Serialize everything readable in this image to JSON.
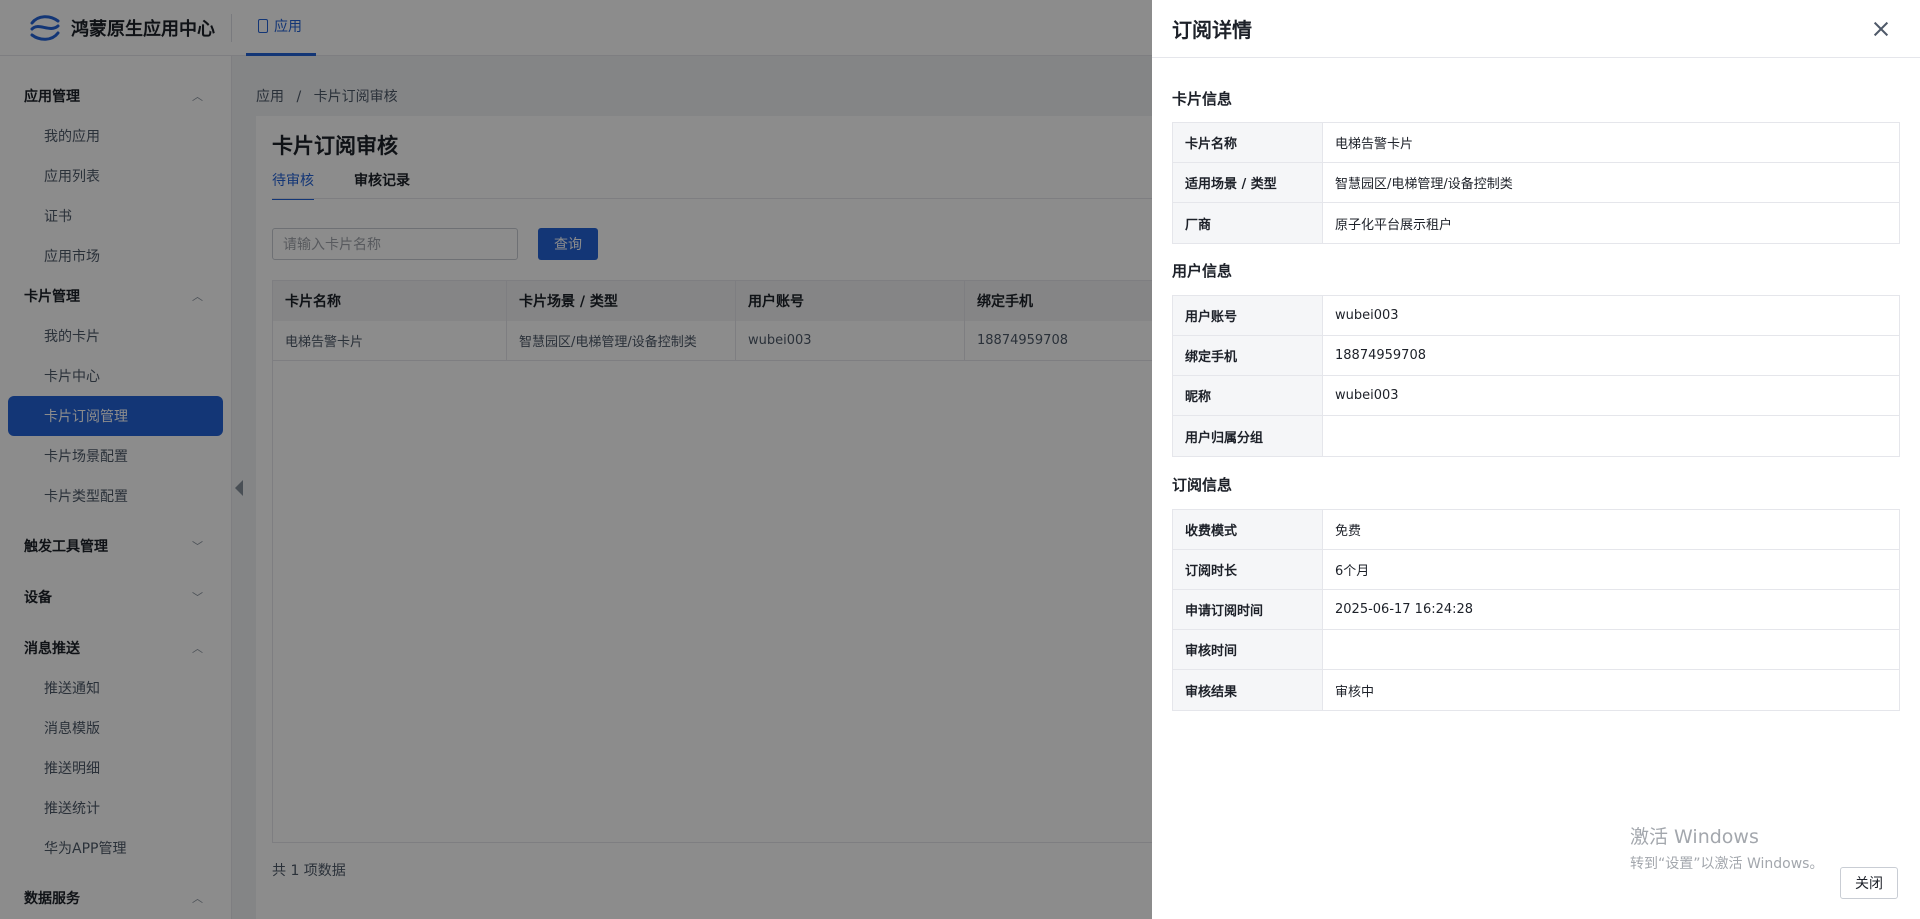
{
  "header": {
    "app_title": "鸿蒙原生应用中心",
    "top_tab": "应用"
  },
  "sidebar": {
    "groups": [
      {
        "label": "应用管理",
        "expanded": true,
        "items": [
          "我的应用",
          "应用列表",
          "证书",
          "应用市场"
        ]
      },
      {
        "label": "卡片管理",
        "expanded": true,
        "items": [
          "我的卡片",
          "卡片中心",
          "卡片订阅管理",
          "卡片场景配置",
          "卡片类型配置"
        ]
      },
      {
        "label": "触发工具管理",
        "expanded": false,
        "items": []
      },
      {
        "label": "设备",
        "expanded": false,
        "items": []
      },
      {
        "label": "消息推送",
        "expanded": true,
        "items": [
          "推送通知",
          "消息模版",
          "推送明细",
          "推送统计",
          "华为APP管理"
        ]
      },
      {
        "label": "数据服务",
        "expanded": true,
        "items": []
      }
    ],
    "active_item": "卡片订阅管理"
  },
  "breadcrumb": [
    "应用",
    "/",
    "卡片订阅审核"
  ],
  "page": {
    "title": "卡片订阅审核",
    "tabs": [
      "待审核",
      "审核记录"
    ],
    "active_tab": "待审核",
    "search_placeholder": "请输入卡片名称",
    "query_label": "查询",
    "table": {
      "columns": [
        "卡片名称",
        "卡片场景 / 类型",
        "用户账号",
        "绑定手机"
      ],
      "rows": [
        [
          "电梯告警卡片",
          "智慧园区/电梯管理/设备控制类",
          "wubei003",
          "18874959708"
        ]
      ]
    },
    "total": "共 1 项数据"
  },
  "drawer": {
    "title": "订阅详情",
    "sections": [
      {
        "title": "卡片信息",
        "rows": [
          {
            "label": "卡片名称",
            "value": "电梯告警卡片"
          },
          {
            "label": "适用场景 / 类型",
            "value": "智慧园区/电梯管理/设备控制类"
          },
          {
            "label": "厂商",
            "value": "原子化平台展示租户"
          }
        ]
      },
      {
        "title": "用户信息",
        "rows": [
          {
            "label": "用户账号",
            "value": "wubei003"
          },
          {
            "label": "绑定手机",
            "value": "18874959708"
          },
          {
            "label": "昵称",
            "value": "wubei003"
          },
          {
            "label": "用户归属分组",
            "value": ""
          }
        ]
      },
      {
        "title": "订阅信息",
        "rows": [
          {
            "label": "收费模式",
            "value": "免费"
          },
          {
            "label": "订阅时长",
            "value": "6个月"
          },
          {
            "label": "申请订阅时间",
            "value": "2025-06-17 16:24:28"
          },
          {
            "label": "审核时间",
            "value": ""
          },
          {
            "label": "审核结果",
            "value": "审核中"
          }
        ]
      }
    ],
    "close_label": "关闭"
  },
  "watermark": {
    "line1": "激活 Windows",
    "line2": "转到“设置”以激活 Windows。"
  }
}
